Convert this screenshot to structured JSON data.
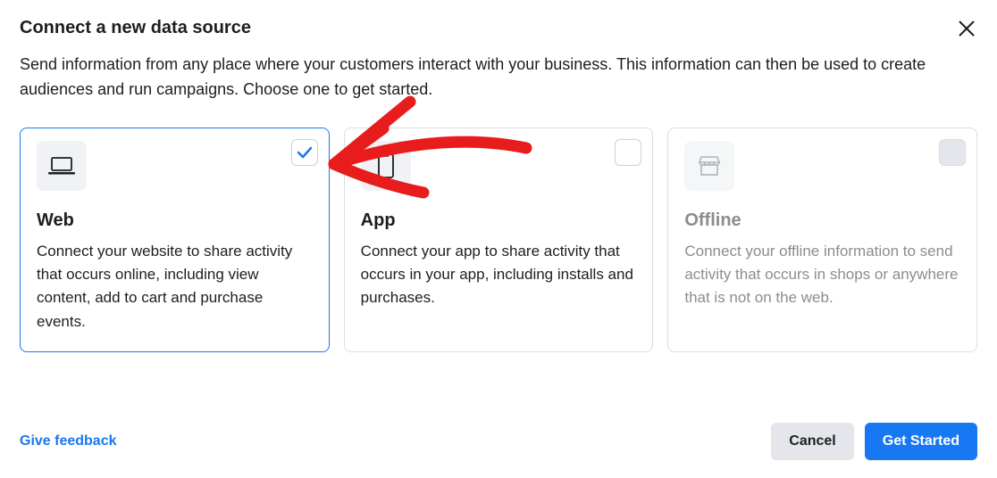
{
  "modal": {
    "title": "Connect a new data source",
    "subtitle": "Send information from any place where your customers interact with your business. This information can then be used to create audiences and run campaigns. Choose one to get started."
  },
  "cards": {
    "web": {
      "title": "Web",
      "description": "Connect your website to share activity that occurs online, including view content, add to cart and purchase events."
    },
    "app": {
      "title": "App",
      "description": "Connect your app to share activity that occurs in your app, including installs and purchases."
    },
    "offline": {
      "title": "Offline",
      "description": "Connect your offline information to send activity that occurs in shops or anywhere that is not on the web."
    }
  },
  "footer": {
    "feedback": "Give feedback",
    "cancel": "Cancel",
    "get_started": "Get Started"
  }
}
